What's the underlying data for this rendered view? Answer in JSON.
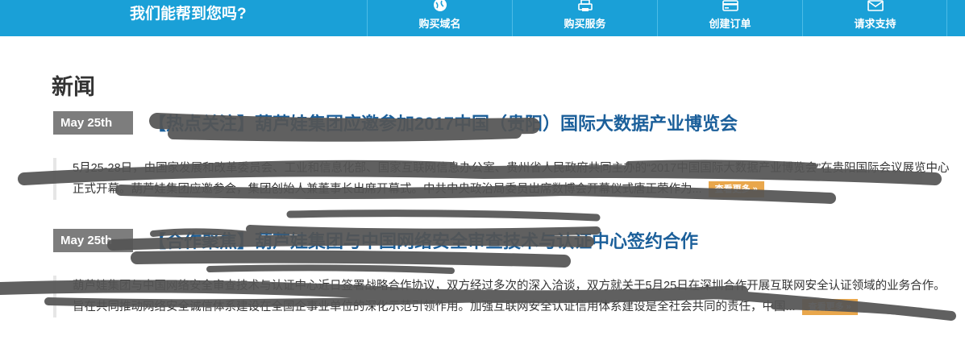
{
  "topbar": {
    "help_text": "我们能帮到您吗?",
    "nav": [
      {
        "label": "购买域名",
        "icon": "globe-icon"
      },
      {
        "label": "购买服务",
        "icon": "printer-icon"
      },
      {
        "label": "创建订单",
        "icon": "credit-card-icon"
      },
      {
        "label": "请求支持",
        "icon": "envelope-icon"
      }
    ],
    "bg_color": "#1aa0d7"
  },
  "page": {
    "title": "新闻"
  },
  "news": [
    {
      "date": "May 25th",
      "headline": "【热点关注】葫芦娃集团应邀参加2017中国（贵阳）国际大数据产业博览会",
      "excerpt": "5月25-28日，由国家发展和改革委员会、工业和信息化部、国家互联网信息办公室、贵州省人民政府共同主办的“2017中国国际大数据产业博览会”在贵阳国际会议展览中心正式开幕。葫芦娃集团应邀参会，集团创始人兼董事长出席开幕式。中共中央政治局委员出席数博会开幕仪式唐正荣作为...",
      "more_label": "查看更多 »"
    },
    {
      "date": "May 25th",
      "headline": "【合作聚焦】葫芦娃集团与中国网络安全审查技术与认证中心签约合作",
      "excerpt": "葫芦娃集团与中国网络安全审查技术与认证中心近日签署战略合作协议，双方经过多次的深入洽谈，双方就关于5月25日在深圳合作开展互联网安全认证领域的业务合作。旨在共同推动网络安全诚信体系建设在全国企事业单位的深化示范引领作用。加强互联网安全认证信用体系建设是全社会共同的责任，中国...",
      "more_label": "查看更多 »"
    }
  ],
  "colors": {
    "accent": "#1aa0d7",
    "headline": "#1b5f9a",
    "date_bg": "#7d7d7d",
    "more_bg": "#e9a74c"
  }
}
